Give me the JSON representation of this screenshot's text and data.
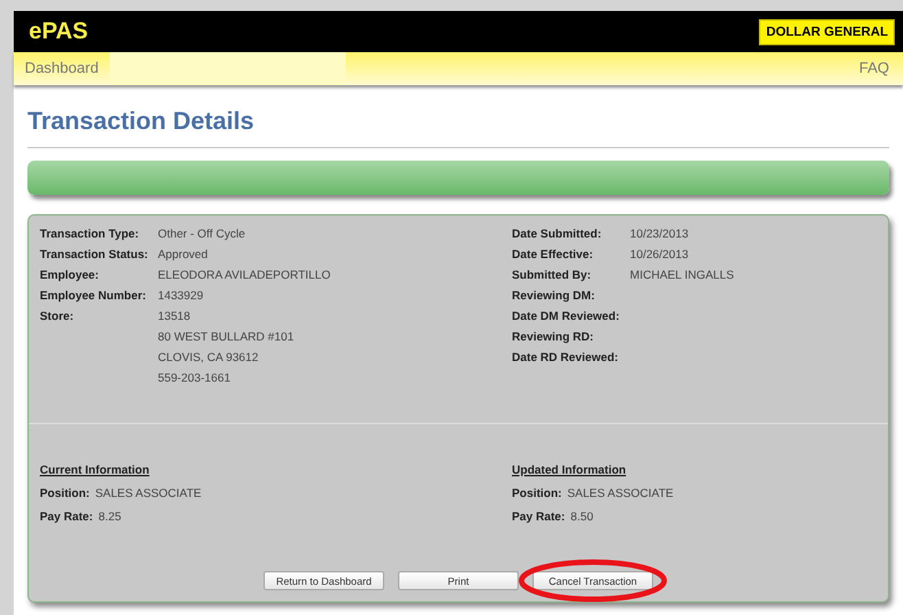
{
  "header": {
    "app_name": "ePAS",
    "brand": "DOLLAR GENERAL"
  },
  "nav": {
    "items": [
      {
        "label": "Dashboard",
        "selected": true
      }
    ],
    "faq": "FAQ"
  },
  "page_title": "Transaction Details",
  "details_left": [
    {
      "label": "Transaction Type:",
      "values": [
        "Other - Off Cycle"
      ]
    },
    {
      "label": "Transaction Status:",
      "values": [
        "Approved"
      ]
    },
    {
      "label": "Employee:",
      "values": [
        "ELEODORA AVILADEPORTILLO"
      ]
    },
    {
      "label": "Employee Number:",
      "values": [
        "1433929"
      ]
    },
    {
      "label": "Store:",
      "values": [
        "13518",
        "80 WEST BULLARD #101",
        "CLOVIS, CA 93612",
        "559-203-1661"
      ]
    }
  ],
  "details_right": [
    {
      "label": "Date Submitted:",
      "values": [
        "10/23/2013"
      ]
    },
    {
      "label": "Date Effective:",
      "values": [
        "10/26/2013"
      ]
    },
    {
      "label": "Submitted By:",
      "values": [
        "MICHAEL INGALLS"
      ]
    },
    {
      "label": "Reviewing DM:"
    },
    {
      "label": "Date DM Reviewed:"
    },
    {
      "label": "Reviewing RD:"
    },
    {
      "label": "Date RD Reviewed:"
    }
  ],
  "current_info": {
    "heading": "Current Information",
    "fields": [
      {
        "label": "Position:",
        "value": "SALES ASSOCIATE"
      },
      {
        "label": "Pay Rate:",
        "value": "8.25"
      }
    ]
  },
  "updated_info": {
    "heading": "Updated Information",
    "fields": [
      {
        "label": "Position:",
        "value": "SALES ASSOCIATE"
      },
      {
        "label": "Pay Rate:",
        "value": "8.50"
      }
    ]
  },
  "buttons": [
    {
      "label": "Return to Dashboard",
      "circled": false
    },
    {
      "label": "Print",
      "circled": false
    },
    {
      "label": "Cancel Transaction",
      "circled": true
    }
  ]
}
